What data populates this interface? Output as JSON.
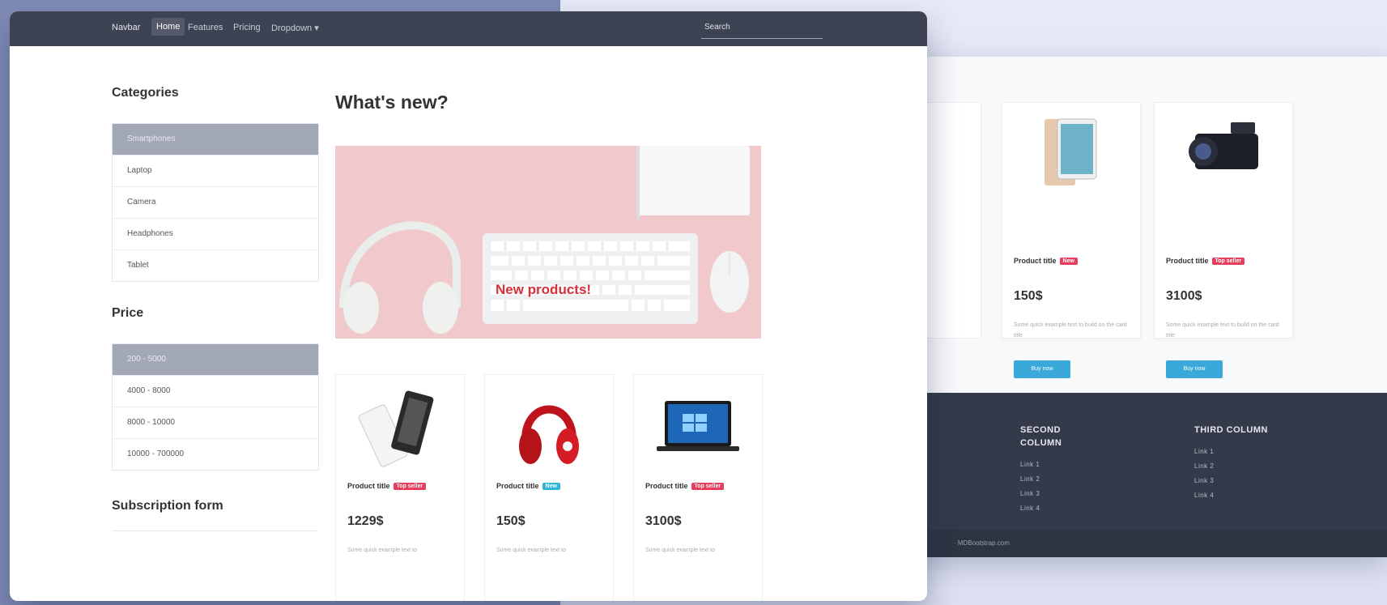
{
  "navbar": {
    "brand": "Navbar",
    "items": [
      {
        "label": "Home",
        "active": true
      },
      {
        "label": "Features"
      },
      {
        "label": "Pricing"
      },
      {
        "label": "Dropdown ▾"
      }
    ],
    "search_placeholder": "Search"
  },
  "sidebar": {
    "categories_title": "Categories",
    "categories": [
      "Smartphones",
      "Laptop",
      "Camera",
      "Headphones",
      "Tablet"
    ],
    "price_title": "Price",
    "price_ranges": [
      "200 - 5000",
      "4000 - 8000",
      "8000 - 10000",
      "10000 - 700000"
    ],
    "subscription_title": "Subscription form"
  },
  "main": {
    "whats_new": "What's new?",
    "banner_text": "New products!",
    "products": [
      {
        "title": "Product title",
        "badge": "Top seller",
        "badge_color": "#e63e5c",
        "price": "1229$",
        "desc": "Some quick example text to"
      },
      {
        "title": "Product title",
        "badge": "New",
        "badge_color": "#2fb6d6",
        "price": "150$",
        "desc": "Some quick example text to"
      },
      {
        "title": "Product title",
        "badge": "Top seller",
        "badge_color": "#e63e5c",
        "price": "3100$",
        "desc": "Some quick example text to"
      }
    ]
  },
  "back_page": {
    "products": [
      {
        "title": "Product title",
        "badge": "New",
        "badge_color": "#e63e5c",
        "price": "150$",
        "desc": "Some quick example text to build on the card title",
        "button": "Buy now"
      },
      {
        "title": "Product title",
        "badge": "Top seller",
        "badge_color": "#e63e5c",
        "price": "3100$",
        "desc": "Some quick example text to build on the card title",
        "button": "Buy now"
      }
    ],
    "footer": {
      "col2_title": "SECOND COLUMN",
      "col2_links": [
        "Link 1",
        "Link 2",
        "Link 3",
        "Link 4"
      ],
      "col3_title": "THIRD COLUMN",
      "col3_links": [
        "Link 1",
        "Link 2",
        "Link 3",
        "Link 4"
      ],
      "copyright": "· MDBootstrap.com"
    }
  }
}
